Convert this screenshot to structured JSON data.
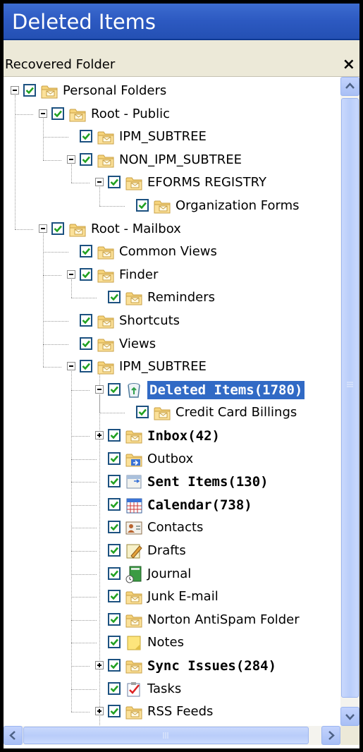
{
  "title": "Deleted Items",
  "panel": {
    "header": "Recovered Folder",
    "close_glyph": "×"
  },
  "colors": {
    "title_bar": "#2c59c1",
    "selection": "#316ac5",
    "checkbox_border": "#1c5180",
    "folder": "#f3cf72"
  },
  "tree": [
    {
      "label": "Personal Folders",
      "level": 0,
      "expander": "minus",
      "icon": "folder-icon",
      "bold": false
    },
    {
      "label": "Root - Public",
      "level": 1,
      "expander": "minus",
      "icon": "folder-icon",
      "bold": false
    },
    {
      "label": "IPM_SUBTREE",
      "level": 2,
      "expander": "none",
      "icon": "folder-icon",
      "bold": false
    },
    {
      "label": "NON_IPM_SUBTREE",
      "level": 2,
      "expander": "minus",
      "icon": "folder-icon",
      "bold": false
    },
    {
      "label": "EFORMS REGISTRY",
      "level": 3,
      "expander": "minus",
      "icon": "folder-icon",
      "bold": false
    },
    {
      "label": "Organization Forms",
      "level": 4,
      "expander": "none",
      "icon": "folder-icon",
      "bold": false
    },
    {
      "label": "Root - Mailbox",
      "level": 1,
      "expander": "minus",
      "icon": "folder-icon",
      "bold": false
    },
    {
      "label": "Common Views",
      "level": 2,
      "expander": "none",
      "icon": "folder-icon",
      "bold": false
    },
    {
      "label": "Finder",
      "level": 2,
      "expander": "minus",
      "icon": "folder-icon",
      "bold": false
    },
    {
      "label": "Reminders",
      "level": 3,
      "expander": "none",
      "icon": "folder-icon",
      "bold": false
    },
    {
      "label": "Shortcuts",
      "level": 2,
      "expander": "none",
      "icon": "folder-icon",
      "bold": false
    },
    {
      "label": "Views",
      "level": 2,
      "expander": "none",
      "icon": "folder-icon",
      "bold": false
    },
    {
      "label": "IPM_SUBTREE",
      "level": 2,
      "expander": "minus",
      "icon": "folder-icon",
      "bold": false
    },
    {
      "label": "Deleted Items(1780)",
      "level": 3,
      "expander": "minus",
      "icon": "recycle-bin-icon",
      "bold": true,
      "selected": true
    },
    {
      "label": "Credit Card Billings",
      "level": 4,
      "expander": "none",
      "icon": "folder-icon",
      "bold": false
    },
    {
      "label": "Inbox(42)",
      "level": 3,
      "expander": "plus",
      "icon": "folder-icon",
      "bold": true
    },
    {
      "label": "Outbox",
      "level": 3,
      "expander": "none",
      "icon": "outbox-icon",
      "bold": false
    },
    {
      "label": "Sent Items(130)",
      "level": 3,
      "expander": "none",
      "icon": "sent-items-icon",
      "bold": true
    },
    {
      "label": "Calendar(738)",
      "level": 3,
      "expander": "none",
      "icon": "calendar-icon",
      "bold": true
    },
    {
      "label": "Contacts",
      "level": 3,
      "expander": "none",
      "icon": "contacts-icon",
      "bold": false
    },
    {
      "label": "Drafts",
      "level": 3,
      "expander": "none",
      "icon": "drafts-icon",
      "bold": false
    },
    {
      "label": "Journal",
      "level": 3,
      "expander": "none",
      "icon": "journal-icon",
      "bold": false
    },
    {
      "label": "Junk E-mail",
      "level": 3,
      "expander": "none",
      "icon": "folder-icon",
      "bold": false
    },
    {
      "label": "Norton AntiSpam Folder",
      "level": 3,
      "expander": "none",
      "icon": "folder-icon",
      "bold": false
    },
    {
      "label": "Notes",
      "level": 3,
      "expander": "none",
      "icon": "notes-icon",
      "bold": false
    },
    {
      "label": "Sync Issues(284)",
      "level": 3,
      "expander": "plus",
      "icon": "folder-icon",
      "bold": true
    },
    {
      "label": "Tasks",
      "level": 3,
      "expander": "none",
      "icon": "tasks-icon",
      "bold": false
    },
    {
      "label": "RSS Feeds",
      "level": 3,
      "expander": "plus",
      "icon": "folder-icon",
      "bold": false
    }
  ],
  "scrollbars": {
    "vertical": {
      "up": "scroll-up-arrow-icon",
      "down": "scroll-down-arrow-icon"
    },
    "horizontal": {
      "left": "scroll-left-arrow-icon",
      "right": "scroll-right-arrow-icon"
    }
  }
}
